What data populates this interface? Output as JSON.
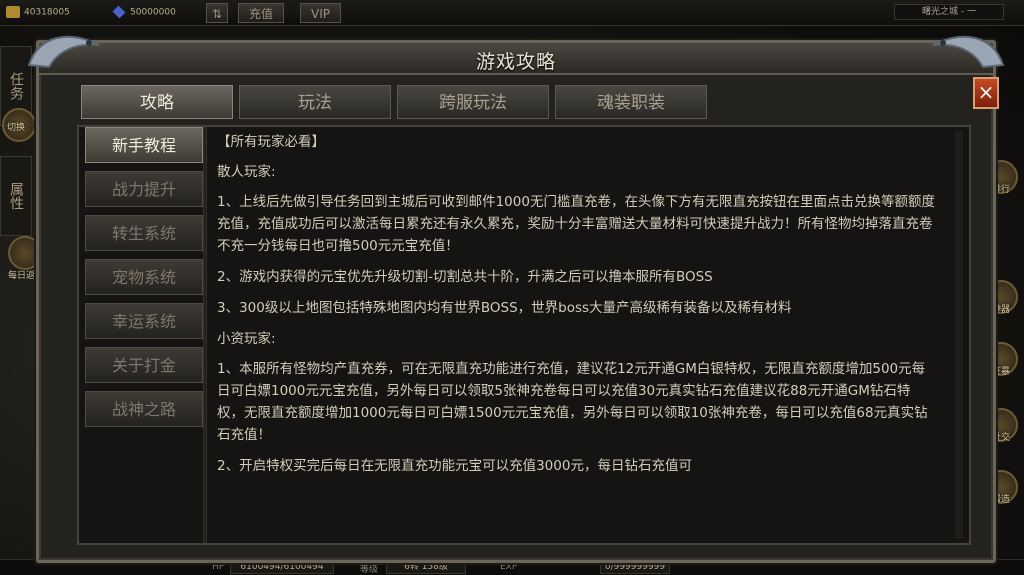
{
  "hud": {
    "gold": "40318005",
    "diamond": "50000000",
    "recharge_label": "充值",
    "vip_label": "VIP",
    "map_name": "曙光之城 - 一",
    "left_tabs": [
      "任务",
      "属性"
    ],
    "switch_label": "切换",
    "daily_label": "每日返利",
    "right_labels": [
      "排行",
      "神器",
      "狂暴",
      "社交",
      "锻造"
    ]
  },
  "bottom": {
    "hp_label": "HP",
    "hp_value": "6100494/6100494",
    "level_label": "等级",
    "level_value": "6转 158级",
    "exp_label": "EXP",
    "exp_value": "0/999999999"
  },
  "dialog": {
    "title": "游戏攻略",
    "close_label": "×",
    "tabs": [
      {
        "label": "攻略",
        "active": true
      },
      {
        "label": "玩法",
        "active": false
      },
      {
        "label": "跨服玩法",
        "active": false
      },
      {
        "label": "魂装职装",
        "active": false
      }
    ],
    "side_items": [
      {
        "label": "新手教程",
        "active": true
      },
      {
        "label": "战力提升",
        "active": false
      },
      {
        "label": "转生系统",
        "active": false
      },
      {
        "label": "宠物系统",
        "active": false
      },
      {
        "label": "幸运系统",
        "active": false
      },
      {
        "label": "关于打金",
        "active": false
      },
      {
        "label": "战神之路",
        "active": false
      }
    ],
    "content": [
      "【所有玩家必看】",
      "散人玩家:",
      "1、上线后先做引导任务回到主城后可收到邮件1000无门槛直充卷，在头像下方有无限直充按钮在里面点击兑换等额额度充值，充值成功后可以激活每日累充还有永久累充，奖励十分丰富赠送大量材料可快速提升战力！所有怪物均掉落直充卷不充一分钱每日也可撸500元元宝充值！",
      "2、游戏内获得的元宝优先升级切割-切割总共十阶，升满之后可以撸本服所有BOSS",
      "3、300级以上地图包括特殊地图内均有世界BOSS，世界boss大量产高级稀有装备以及稀有材料",
      "小资玩家:",
      "1、本服所有怪物均产直充券，可在无限直充功能进行充值，建议花12元开通GM白银特权，无限直充额度增加500元每日可白嫖1000元元宝充值，另外每日可以领取5张神充卷每日可以充值30元真实钻石充值建议花88元开通GM钻石特权，无限直充额度增加1000元每日可白嫖1500元元宝充值，另外每日可以领取10张神充卷，每日可以充值68元真实钻石充值！",
      "2、开启特权买完后每日在无限直充功能元宝可以充值3000元，每日钻石充值可"
    ]
  }
}
